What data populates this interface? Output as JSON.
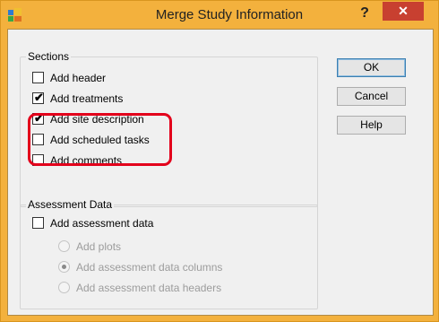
{
  "window": {
    "title": "Merge Study Information",
    "help_glyph": "?",
    "close_glyph": "✕"
  },
  "sections": {
    "title": "Sections",
    "items": [
      {
        "label": "Add header",
        "checked": false
      },
      {
        "label": "Add treatments",
        "checked": true
      },
      {
        "label": "Add site description",
        "checked": true
      },
      {
        "label": "Add scheduled tasks",
        "checked": false
      },
      {
        "label": "Add comments",
        "checked": false
      }
    ]
  },
  "assessment": {
    "title": "Assessment Data",
    "checkbox_label": "Add assessment data",
    "checked": false,
    "radios": [
      {
        "label": "Add plots",
        "selected": false
      },
      {
        "label": "Add assessment data columns",
        "selected": true
      },
      {
        "label": "Add assessment data headers",
        "selected": false
      }
    ]
  },
  "buttons": {
    "ok": "OK",
    "cancel": "Cancel",
    "help": "Help"
  },
  "check_glyph": "✔",
  "colors": {
    "title_bar": "#f3b13d",
    "close_button": "#c84030",
    "highlight": "#e3001b"
  }
}
